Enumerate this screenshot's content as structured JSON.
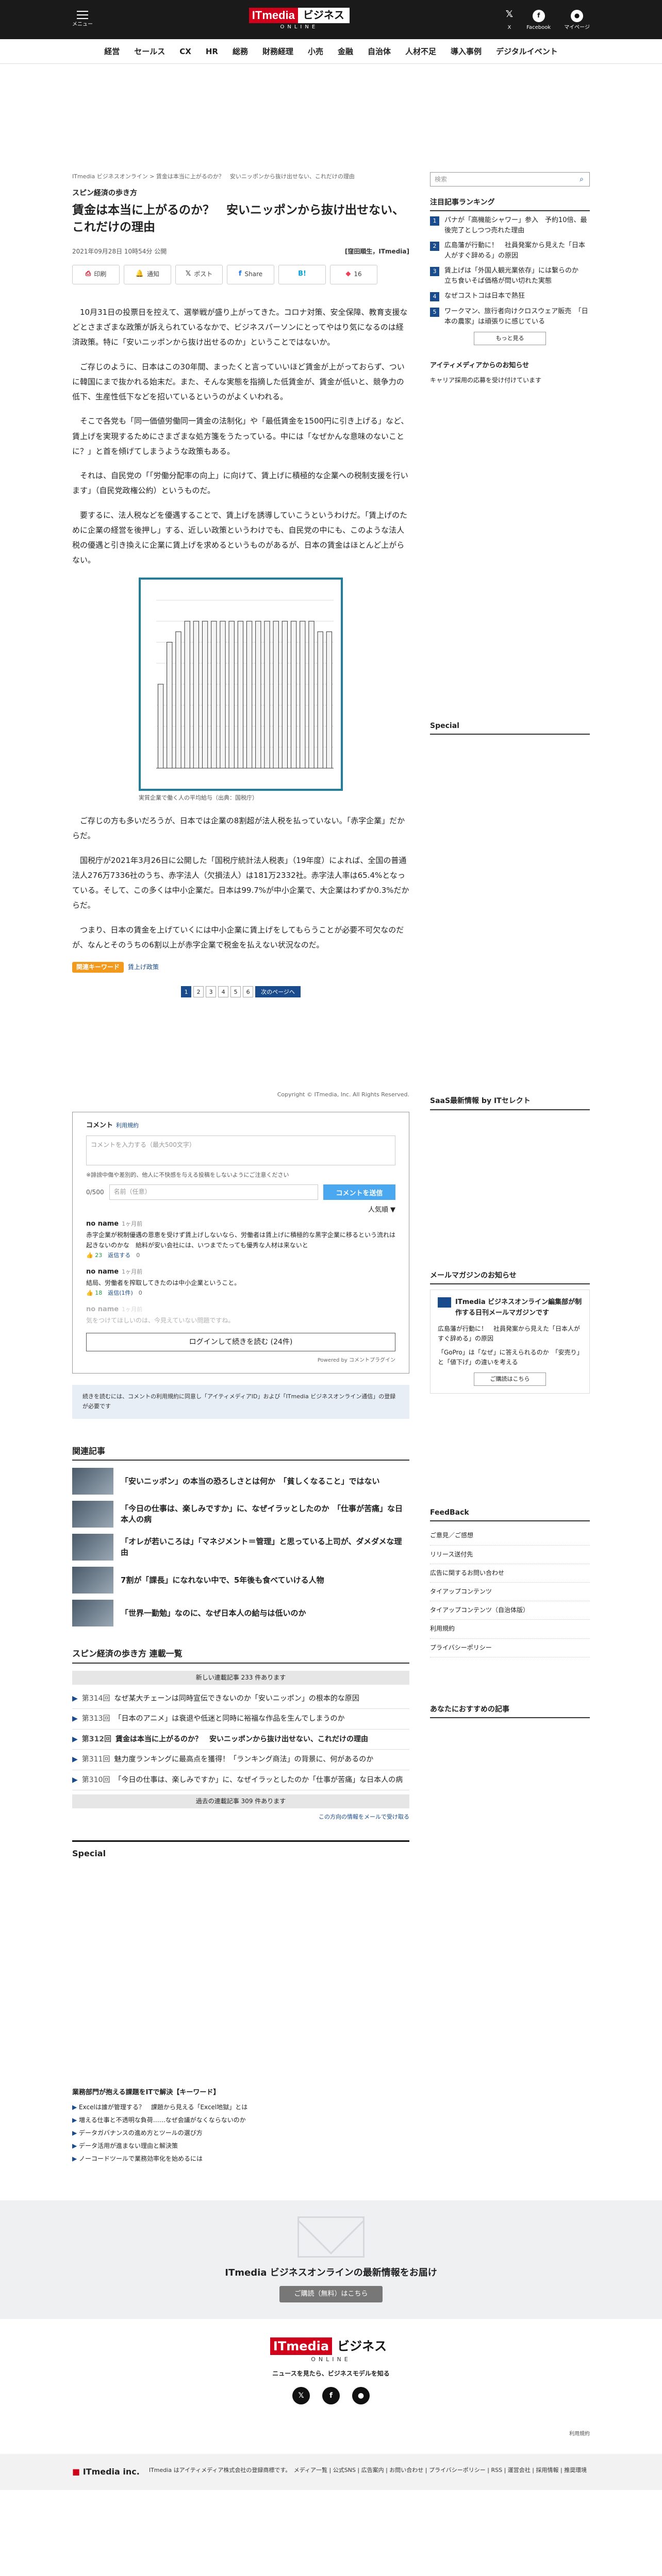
{
  "header": {
    "menu_label": "メニュー",
    "logo_it": "ITmedia",
    "logo_rest": "ビジネス",
    "logo_sub": "ONLINE",
    "x_label": "X",
    "facebook_label": "Facebook",
    "mypage_label": "マイページ"
  },
  "categories": [
    "経営",
    "セールス",
    "CX",
    "HR",
    "総務",
    "財務経理",
    "小売",
    "金融",
    "自治体",
    "人材不足",
    "導入事例",
    "デジタルイベント"
  ],
  "breadcrumb": "ITmedia ビジネスオンライン > 賃金は本当に上がるのか？　安いニッポンから抜け出せない、これだけの理由",
  "article": {
    "series": "スピン経済の歩き方",
    "title": "賃金は本当に上がるのか？　安いニッポンから抜け出せない、これだけの理由",
    "date": "2021年09月28日 10時54分 公開",
    "byline": "[窪田順生，ITmedia]",
    "share": {
      "pdf": "印刷",
      "mail": "通知",
      "x": "ポスト",
      "facebook": "Share",
      "hatena": "B!",
      "pocket": "16"
    },
    "paragraphs": [
      "10月31日の投票日を控えて、選挙戦が盛り上がってきた。コロナ対策、安全保障、教育支援などとさまざまな政策が訴えられているなかで、ビジネスパーソンにとってやはり気になるのは経済政策。特に「安いニッポンから抜け出せるのか」ということではないか。",
      "ご存じのように、日本はこの30年間、まったくと言っていいほど賃金が上がっておらず、ついに韓国にまで抜かれる始末だ。また、そんな実態を指摘した低賃金が、賃金が低いと、競争力の低下、生産性低下などを招いているというのがよくいわれる。",
      "そこで各党も「同一価値労働同一賃金の法制化」や「最低賃金を1500円に引き上げる」など、賃上げを実現するためにさまざまな処方箋をうたっている。中には「なぜかんな意味のないことに？」と首を傾げてしまうような政策もある。",
      "それは、自民党の「「労働分配率の向上」に向けて、賃上げに積極的な企業への税制支援を行います」（自民党政権公約）というものだ。",
      "要するに、法人税などを優遇することで、賃上げを誘導していこうというわけだ。「賃上げのために企業の経営を後押し」する、近しい政策というわけでも、自民党の中にも、このような法人税の優遇と引き換えに企業に賃上げを求めるというものがあるが、日本の賃金はほとんど上がらない。",
      "ご存じの方も多いだろうが、日本では企業の8割超が法人税を払っていない。「赤字企業」だからだ。",
      "国税庁が2021年3月26日に公開した「国税庁統計法人税表」（19年度）によれば、全国の普通法人276万7336社のうち、赤字法人（欠損法人）は181万2332社。赤字法人率は65.4%となっている。そして、この多くは中小企業だ。日本は99.7%が中小企業で、大企業はわずか0.3%だからだ。",
      "つまり、日本の賃金を上げていくには中小企業に賃上げをしてもらうことが必要不可欠なのだが、なんとそのうちの6割以上が赤字企業で税金を払えない状況なのだ。"
    ],
    "figure_caption": "実質企業で働く人の平均給与（出典：国税庁）",
    "tag": "関連キーワード",
    "tag_link": "賃上げ政策",
    "pager": [
      "1",
      "2",
      "3",
      "4",
      "5",
      "6"
    ],
    "next_label": "次のページへ"
  },
  "chart_data": {
    "type": "bar",
    "title": "",
    "categories": [
      "",
      "",
      "",
      "",
      "",
      "",
      "",
      "",
      "",
      "",
      "",
      "",
      "",
      "",
      "",
      "",
      "",
      "",
      "",
      ""
    ],
    "values": [
      4,
      6,
      6.5,
      7,
      7,
      7,
      7,
      7,
      7,
      7,
      7,
      7,
      7,
      7,
      7,
      7,
      7,
      7,
      6.5,
      6.5
    ],
    "xlabel": "",
    "ylabel": ""
  },
  "copyright": "Copyright © ITmedia, Inc. All Rights Reserved.",
  "comments": {
    "title": "コメント",
    "help": "利用規約",
    "placeholder": "コメントを入力する（最大500文字）",
    "note": "※誹謗中傷や差別的、他人に不快感を与える投稿をしないようにご注意ください",
    "count": "0/500",
    "name_placeholder": "名前（任意）",
    "submit": "コメントを送信",
    "sort": "人気順 ▼",
    "items": [
      {
        "author": "no name",
        "time": "1ヶ月前",
        "body": "赤字企業が税制優遇の恩恵を受けず賃上げしないなら、労働者は賃上げに積極的な黒字企業に移るという流れは起きないのかな　給料が安い会社には、いつまでたっても優秀な人材は来ないと",
        "good": "23",
        "bad": "返信する",
        "extra": "0"
      },
      {
        "author": "no name",
        "time": "1ヶ月前",
        "body": "結局、労働者を搾取してきたのは中小企業ということ。",
        "good": "18",
        "bad": "返信(1件)",
        "extra": "0"
      },
      {
        "author": "no name",
        "time": "1ヶ月前",
        "body": "気をつけてほしいのは、今見えていない問題ですね。",
        "good": "",
        "bad": "",
        "extra": ""
      }
    ],
    "more": "ログインして続きを読む (24件)",
    "powered": "Powered by コメントプラグイン"
  },
  "notice": "続きを読むには、コメントの利用規約に同意し「アイティメディアID」および「ITmedia ビジネスオンライン通信」の登録が必要です",
  "related": {
    "title": "関連記事",
    "items": [
      "「安いニッポン」の本当の恐ろしさとは何か　「貧しくなること」ではない",
      "「今日の仕事は、楽しみですか」に、なぜイラッとしたのか　「仕事が苦痛」な日本人の病",
      "「オレが若いころは」「マネジメント＝管理」と思っている上司が、ダメダメな理由",
      "7割が「課長」になれない中で、5年後も食べていける人物",
      "「世界一勤勉」なのに、なぜ日本人の給与は低いのか"
    ]
  },
  "series_list": {
    "title": "スピン経済の歩き方 連載一覧",
    "bar_top": "新しい連載記事 233 件あります",
    "items": [
      {
        "num": "第314回",
        "text": "なぜ某大チェーンは同時宣伝できないのか「安いニッポン」の根本的な原因",
        "cur": false
      },
      {
        "num": "第313回",
        "text": "「日本のアニメ」は衰退や低迷と同時に裕福な作品を生んでしまうのか",
        "cur": false
      },
      {
        "num": "第312回",
        "text": "賃金は本当に上がるのか？　安いニッポンから抜け出せない、これだけの理由",
        "cur": true
      },
      {
        "num": "第311回",
        "text": "魅力度ランキングに最高点を獲得！「ランキング商法」の背景に、何があるのか",
        "cur": false
      },
      {
        "num": "第310回",
        "text": "「今日の仕事は、楽しみですか」に、なぜイラッとしたのか「仕事が苦痛」な日本人の病",
        "cur": false
      }
    ],
    "bar_bottom": "過去の連載記事 309 件あります",
    "more": "この方向の情報をメールで受け取る"
  },
  "special_title": "Special",
  "side": {
    "search_placeholder": "検索",
    "ranking_title": "注目記事ランキング",
    "ranking": [
      "パナが「高機能シャワー」参入　予約10倍、最後完了としつつ売れた理由",
      "広島藩が行動に！　社員発案から見えた「日本人がすぐ辞める」の原因",
      "賃上げは「外国人観光業依存」には繋らのか　立ち食いそば価格が問い切れた実態",
      "なぜコストコは日本で熱狂",
      "ワークマン、旅行者向けクロスウェア販売　「日本の農家」は頑張りに感じている"
    ],
    "ranking_more": "もっと見る",
    "weekly_title": "アイティメディアからのお知らせ",
    "weekly_item": "キャリア採用の応募を受け付けています",
    "special_title": "Special",
    "sns_title": "SaaS最新情報 by ITセレクト",
    "mag_title": "メールマガジンのお知らせ",
    "mag_head": "ITmedia ビジネスオンライン編集部が制作する日刊メールマガジンです",
    "mag_items": [
      "広島藩が行動に！　社員発案から見えた「日本人がすぐ辞める」の原因",
      "「GoPro」は「なぜ」に答えられるのか　「安売り」と「値下げ」の違いを考える"
    ],
    "mag_btn": "ご購読はこちら",
    "feed_title": "FeedBack",
    "feed_items": [
      "ご意見／ご感想",
      "リリース送付先",
      "広告に関するお問い合わせ",
      "タイアップコンテンツ",
      "タイアップコンテンツ（自治体版）",
      "利用規約",
      "プライバシーポリシー"
    ],
    "rec_title": "あなたにおすすめの記事"
  },
  "bottom_links": {
    "title": "業務部門が抱える課題をITで解決【キーワード】",
    "items": [
      "Excelは誰が管理する？　課題から見える「Excel地獄」とは",
      "増える仕事と不透明な負荷……なぜ会議がなくならないのか",
      "データガバナンスの進め方とツールの選び方",
      "データ活用が進まない理由と解決策",
      "ノーコードツールで業務効率化を始めるには"
    ]
  },
  "newsletter": {
    "text": "ITmedia ビジネスオンラインの最新情報をお届け",
    "button": "ご購読（無料）はこちら"
  },
  "footer": {
    "logo_it": "ITmedia",
    "logo_rest": "ビジネス",
    "logo_sub": "ONLINE",
    "tagline": "ニュースを見たら、ビジネスモデルを知る",
    "corp_right": "利用規約",
    "corp_logo_it": "ITmedia",
    "corp_logo_rest": " inc.",
    "corp_text": "ITmedia はアイティメディア株式会社の登録商標です。　メディア一覧 | 公式SNS | 広告案内 | お問い合わせ | プライバシーポリシー | RSS | 運営会社 | 採用情報 | 推奨環境"
  }
}
